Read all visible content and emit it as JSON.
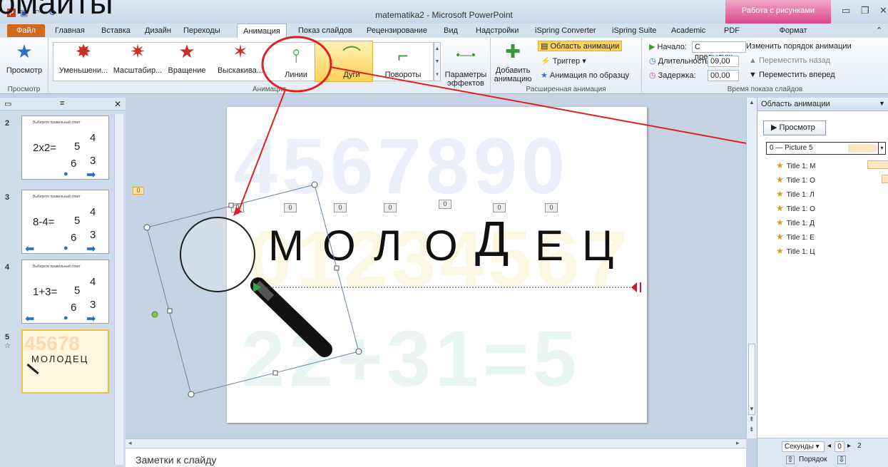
{
  "overlay_title": "омайты",
  "window": {
    "title": "matematika2 - Microsoft PowerPoint",
    "context_tab_title": "Работа с рисунками"
  },
  "tabs": {
    "file": "Файл",
    "items": [
      "Главная",
      "Вставка",
      "Дизайн",
      "Переходы",
      "Анимация",
      "Показ слайдов",
      "Рецензирование",
      "Вид",
      "Надстройки",
      "iSpring Converter",
      "iSpring Suite",
      "Academic",
      "PDF"
    ],
    "format": "Формат"
  },
  "ribbon": {
    "preview": {
      "label": "Просмотр",
      "group": "Просмотр"
    },
    "animation_group": "Анимация",
    "animations": [
      "Уменьшени...",
      "Масштабир...",
      "Вращение",
      "Выскакива...",
      "Линии",
      "Дуги",
      "Повороты"
    ],
    "effect_params": "Параметры эффектов",
    "add_animation": "Добавить анимацию",
    "anim_pane": "Область анимации",
    "trigger": "Триггер",
    "anim_painter": "Анимация по образцу",
    "advanced_group": "Расширенная анимация",
    "start_label": "Начало:",
    "start_value": "С предыдущ...",
    "duration_label": "Длительность:",
    "duration_value": "09,00",
    "delay_label": "Задержка:",
    "delay_value": "00,00",
    "reorder_title": "Изменить порядок анимации",
    "move_back": "Переместить назад",
    "move_forward": "Переместить вперед",
    "timing_group": "Время показа слайдов"
  },
  "slides": [
    {
      "num": "2",
      "heading": "Выберите правильный ответ",
      "eq": "2x2=",
      "a": "5",
      "b": "4",
      "c": "6",
      "d": "3"
    },
    {
      "num": "3",
      "heading": "Выберите правильный ответ",
      "eq": "8-4=",
      "a": "5",
      "b": "4",
      "c": "6",
      "d": "3"
    },
    {
      "num": "4",
      "heading": "Выберите правильный ответ",
      "eq": "1+3=",
      "a": "5",
      "b": "4",
      "c": "6",
      "d": "3"
    },
    {
      "num": "5",
      "word": "МОЛОДЕЦ"
    }
  ],
  "slide": {
    "bg1": "4567890",
    "bg2": "01234567",
    "bg3": "22+31=5",
    "letters": [
      "М",
      "О",
      "Л",
      "О",
      "Д",
      "Е",
      "Ц"
    ],
    "tags": [
      "0",
      "0",
      "0",
      "0",
      "0",
      "0",
      "0"
    ],
    "path_tag": "0"
  },
  "notes": "Заметки к слайду",
  "anim_pane": {
    "title": "Область анимации",
    "preview": "Просмотр",
    "first": "0 — Picture 5",
    "items": [
      "Title 1: М",
      "Title 1: О",
      "Title 1: Л",
      "Title 1: О",
      "Title 1: Д",
      "Title 1: Е",
      "Title 1: Ц"
    ],
    "seconds": "Секунды",
    "sec_value": "0",
    "sec_next": "2",
    "order": "Порядок"
  },
  "colors": {
    "accent": "#d2691e",
    "highlight": "#fcd25a",
    "callout": "#e02020"
  }
}
